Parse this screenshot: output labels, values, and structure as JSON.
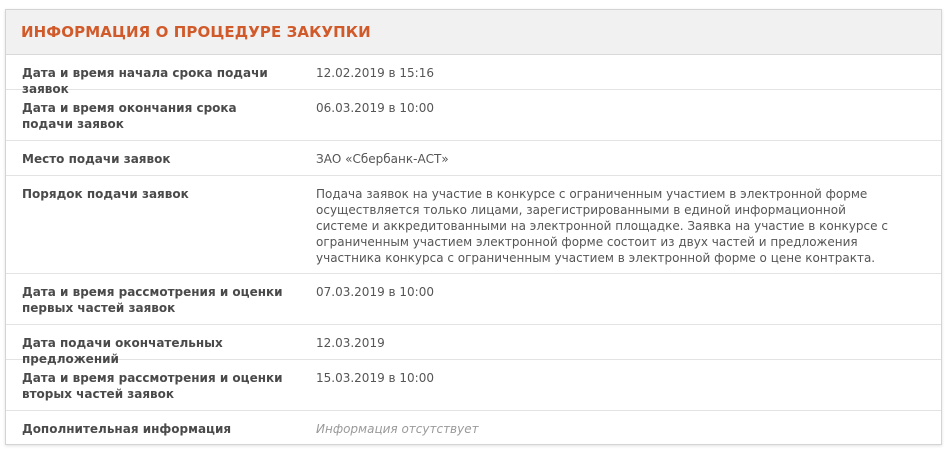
{
  "section": {
    "title": "ИНФОРМАЦИЯ О ПРОЦЕДУРЕ ЗАКУПКИ"
  },
  "rows": [
    {
      "label": "Дата и время начала срока подачи заявок",
      "value": "12.02.2019 в 15:16"
    },
    {
      "label": "Дата и время окончания срока подачи заявок",
      "value": "06.03.2019 в 10:00"
    },
    {
      "label": "Место подачи заявок",
      "value": "ЗАО «Сбербанк-АСТ»"
    },
    {
      "label": "Порядок подачи заявок",
      "value": "Подача заявок на участие в конкурсе с ограниченным участием в электронной форме осуществляется только лицами, зарегистрированными в единой информационной системе и аккредитованными на электронной площадке. Заявка на участие в конкурсе с ограниченным участием электронной форме состоит из двух частей и предложения участника конкурса с ограниченным участием в электронной форме о цене контракта."
    },
    {
      "label": "Дата и время рассмотрения и оценки первых частей заявок",
      "value": "07.03.2019 в 10:00"
    },
    {
      "label": "Дата подачи окончательных предложений",
      "value": "12.03.2019"
    },
    {
      "label": "Дата и время рассмотрения и оценки вторых частей заявок",
      "value": "15.03.2019 в 10:00"
    },
    {
      "label": "Дополнительная информация",
      "value": "Информация отсутствует"
    }
  ]
}
